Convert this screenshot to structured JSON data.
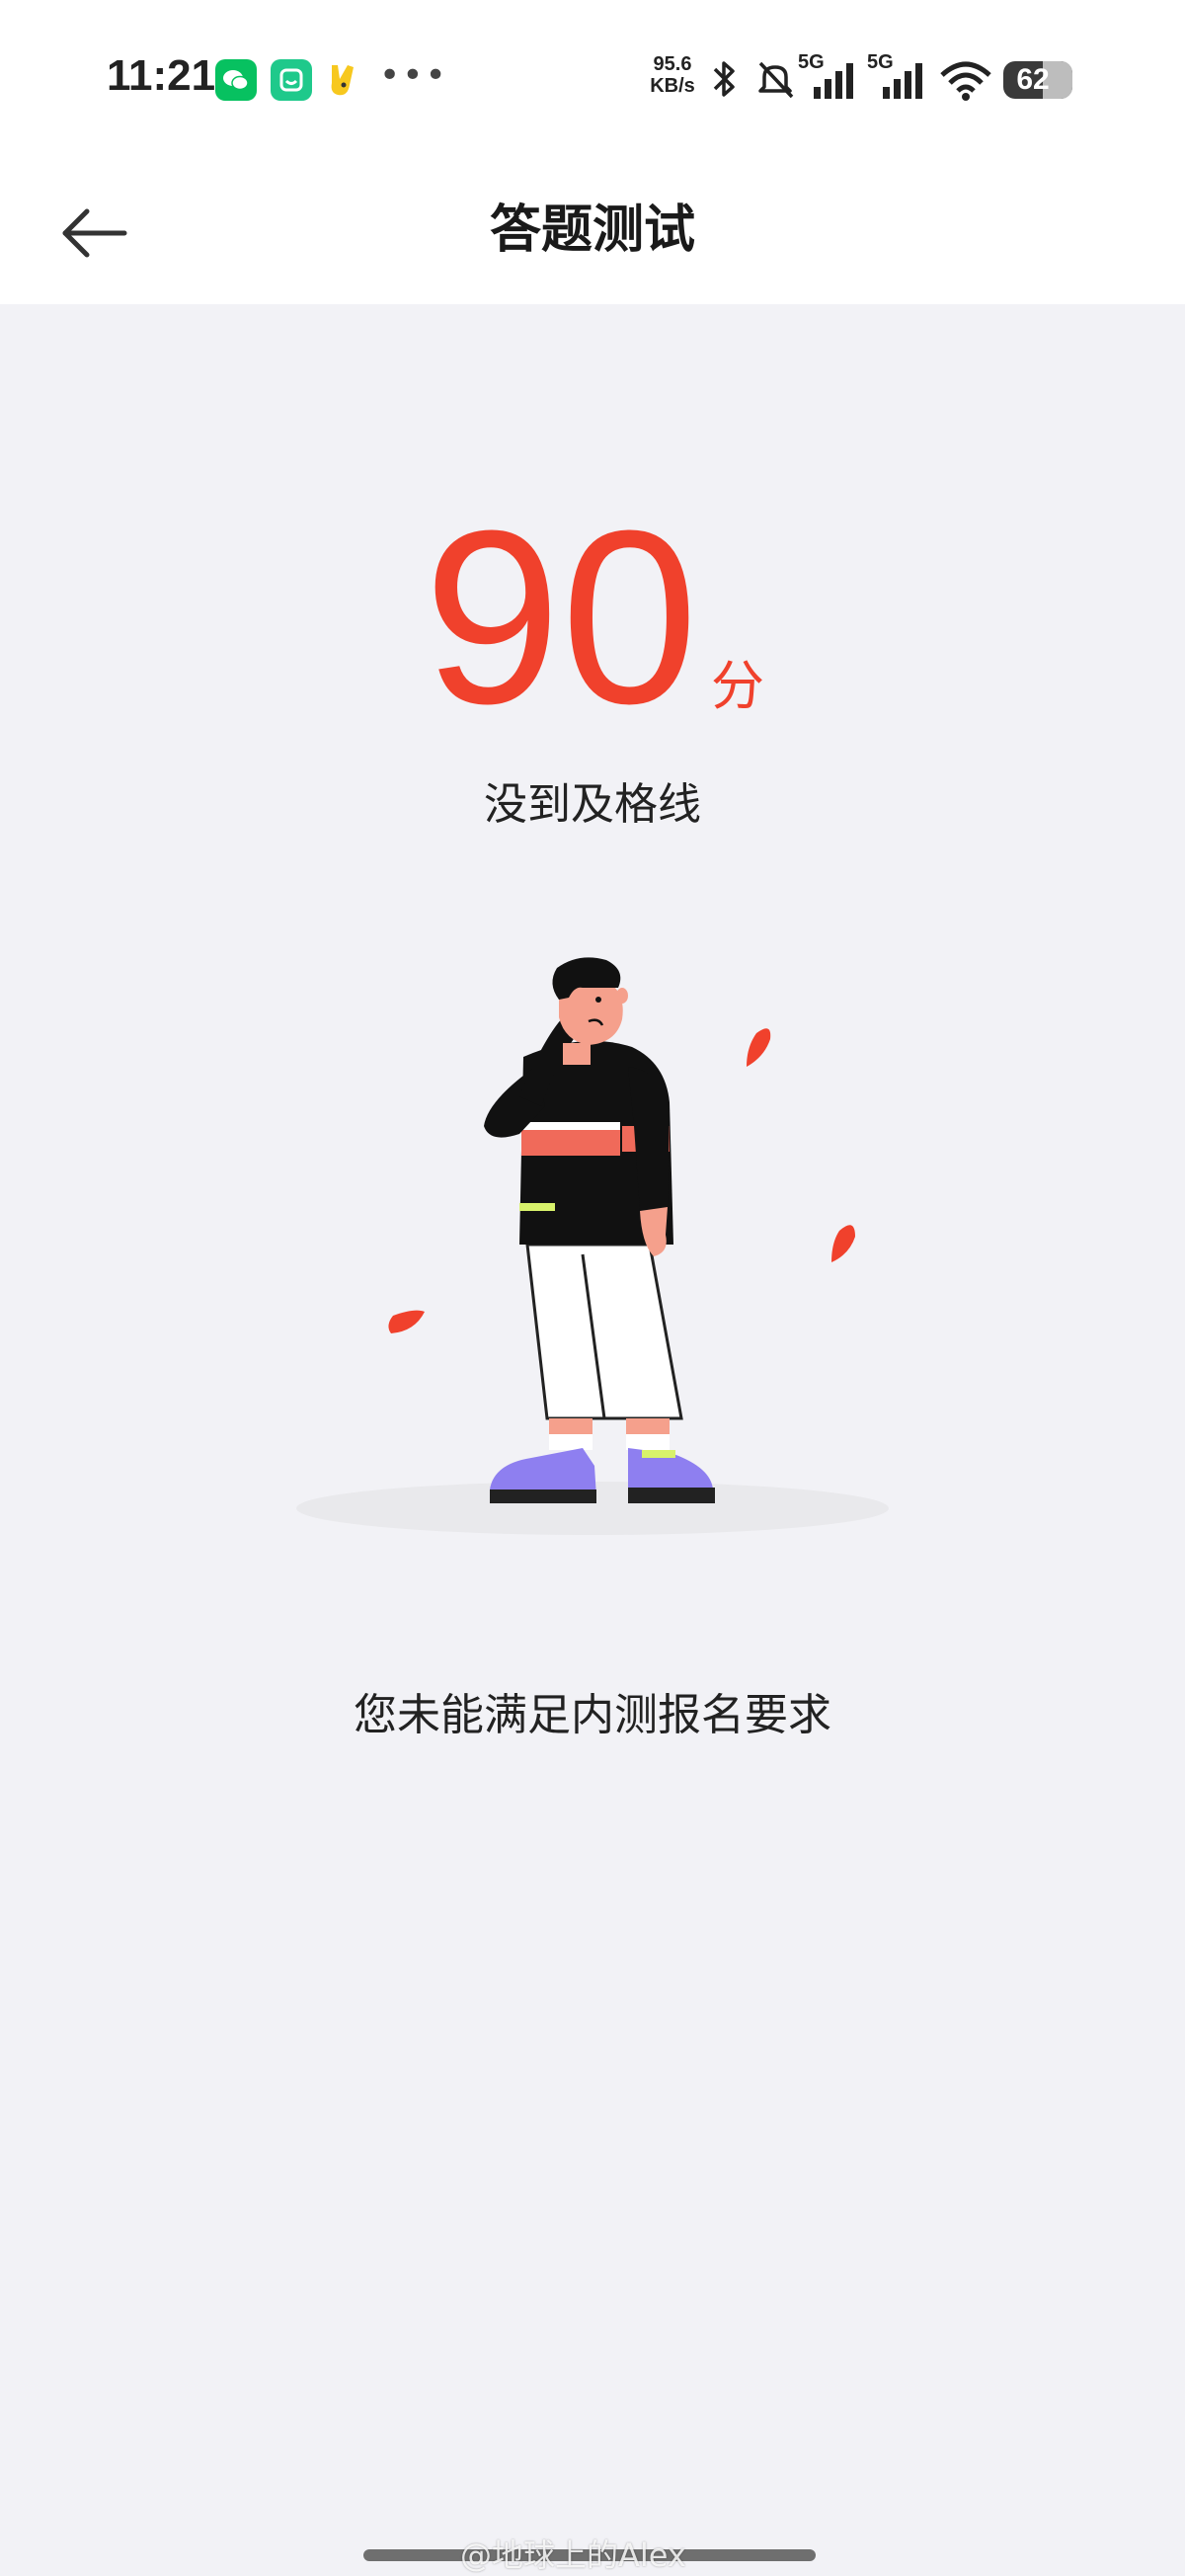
{
  "status_bar": {
    "time": "11:21",
    "net_speed_value": "95.6",
    "net_speed_unit": "KB/s",
    "signal_label_1": "5G",
    "signal_label_2": "5G",
    "battery_level": "62",
    "icons": [
      "wechat-icon",
      "app-icon",
      "app-icon",
      "more-icon",
      "bluetooth-icon",
      "mute-icon",
      "signal-icon",
      "signal-icon",
      "wifi-icon",
      "battery-icon"
    ]
  },
  "nav": {
    "title": "答题测试",
    "back_icon": "back-arrow-icon"
  },
  "result": {
    "score": "90",
    "score_unit": "分",
    "status": "没到及格线",
    "message": "您未能满足内测报名要求"
  },
  "watermark": "@地球上的Alex",
  "colors": {
    "accent": "#f0412c",
    "background": "#f2f2f6",
    "surface": "#ffffff"
  }
}
